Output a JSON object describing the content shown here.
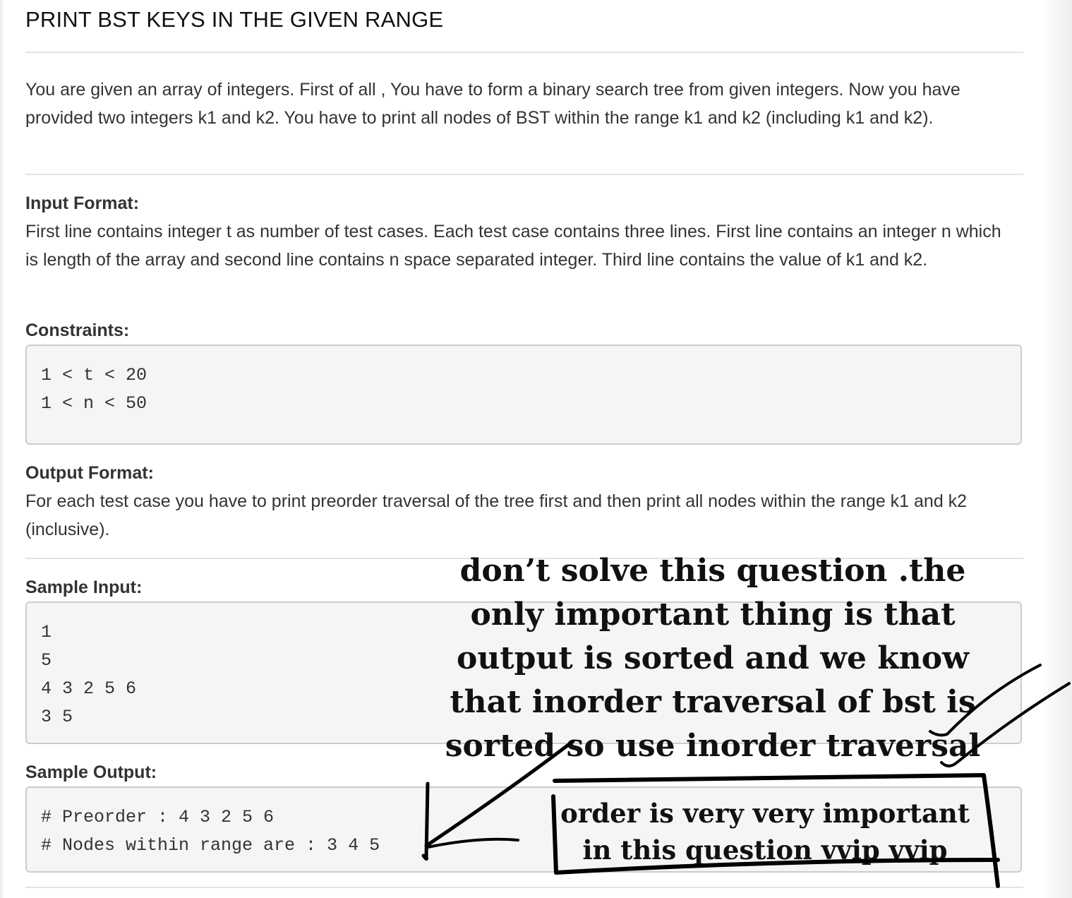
{
  "title": "PRINT BST KEYS IN THE GIVEN RANGE",
  "description": "You are given an array of integers. First of all , You have to form a binary search tree from given integers. Now you have provided two integers k1 and k2. You have to print all nodes of BST within the range k1 and k2 (including k1 and k2).",
  "input_format": {
    "heading": "Input Format:",
    "text": "First line contains integer t as number of test cases. Each test case contains three lines. First line contains an integer n which is length of the array and second line contains n space separated integer. Third line contains the value of k1 and k2."
  },
  "constraints": {
    "heading": "Constraints:",
    "lines": [
      "1 < t < 20",
      "1 < n < 50"
    ]
  },
  "output_format": {
    "heading": "Output Format:",
    "text": "For each test case you have to print preorder traversal of the tree first and then print all nodes within the range k1 and k2 (inclusive)."
  },
  "sample_input": {
    "heading": "Sample Input:",
    "lines": [
      "1",
      "5",
      "4 3 2 5 6",
      "3 5"
    ]
  },
  "sample_output": {
    "heading": "Sample Output:",
    "lines": [
      "# Preorder : 4 3 2 5 6",
      "# Nodes within range are : 3 4 5"
    ]
  },
  "annotations": {
    "main_note": "don’t solve this question .the only important thing is that output is sorted and we know that inorder traversal of bst is sorted so use inorder traversal",
    "boxed_note": "order is very very important in this question vvip vvip"
  }
}
